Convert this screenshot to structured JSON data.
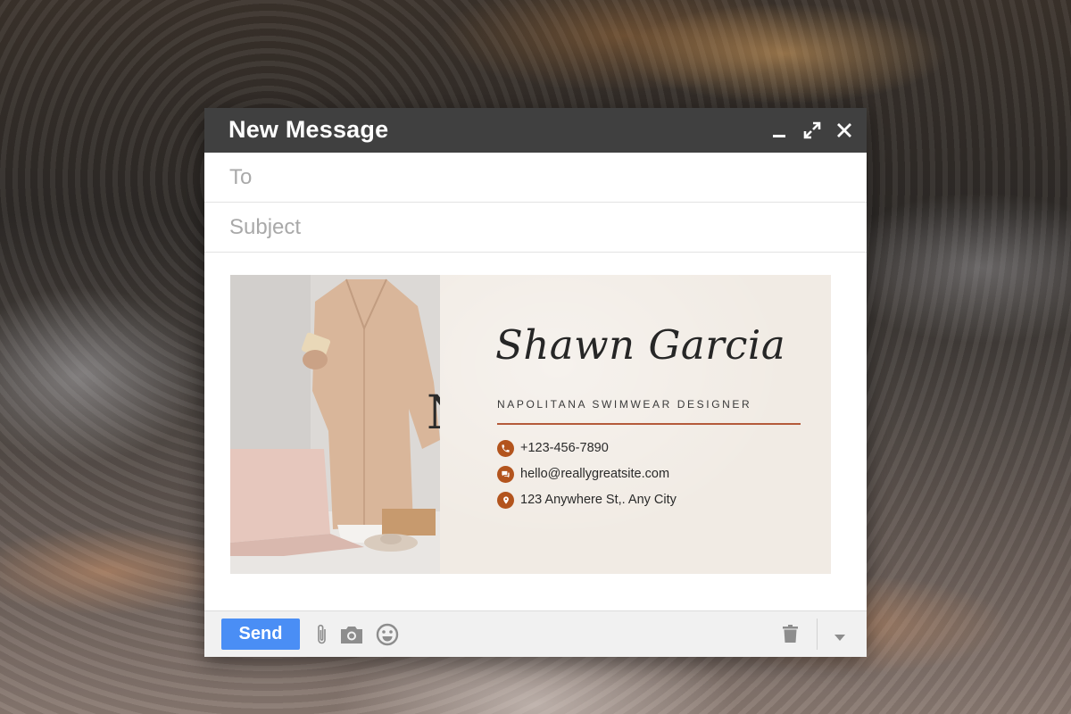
{
  "compose": {
    "title": "New Message",
    "to_placeholder": "To",
    "subject_placeholder": "Subject",
    "window_controls": [
      "minimize-icon",
      "expand-icon",
      "close-icon"
    ]
  },
  "signature": {
    "monogram": "N.",
    "name": "Shawn Garcia",
    "role": "NAPOLITANA SWIMWEAR DESIGNER",
    "accent_color": "#b3541d",
    "contacts": [
      {
        "icon": "phone-icon",
        "text": "+123-456-7890"
      },
      {
        "icon": "chat-icon",
        "text": "hello@reallygreatsite.com"
      },
      {
        "icon": "location-pin-icon",
        "text": "123 Anywhere St,. Any City"
      }
    ]
  },
  "toolbar": {
    "send_label": "Send",
    "send_color": "#4a8ef5",
    "icons": [
      "paperclip-icon",
      "camera-icon",
      "smiley-icon",
      "trash-icon",
      "dropdown-arrow-icon"
    ]
  }
}
